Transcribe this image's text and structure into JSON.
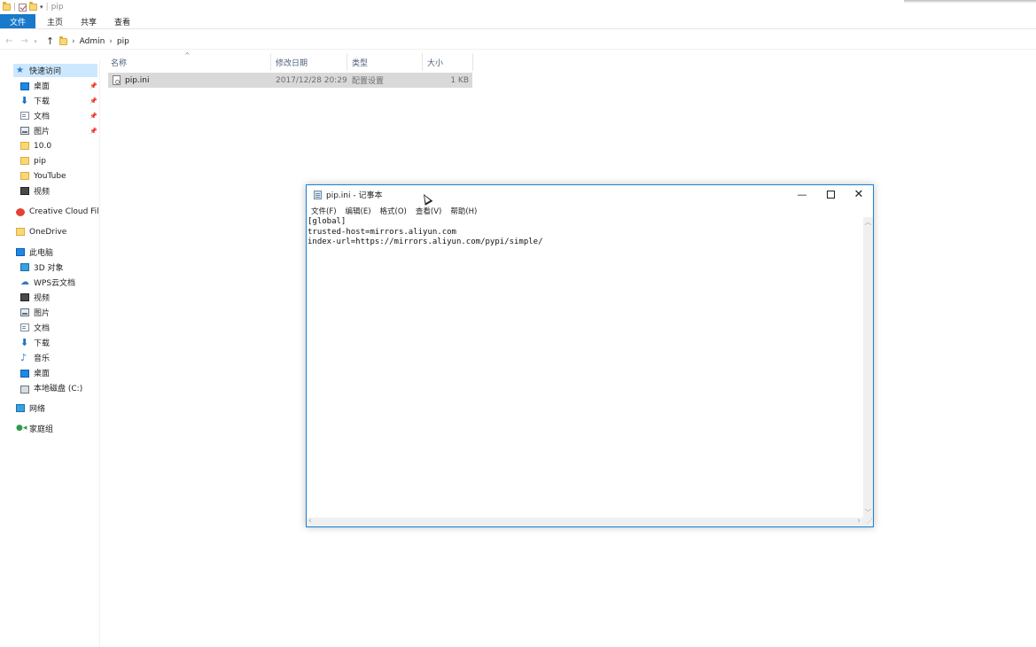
{
  "explorer": {
    "title": "pip",
    "ribbon_tabs": [
      "文件",
      "主页",
      "共享",
      "查看"
    ],
    "breadcrumb": [
      "Admin",
      "pip"
    ],
    "columns": [
      "名称",
      "修改日期",
      "类型",
      "大小"
    ],
    "files": [
      {
        "name": "pip.ini",
        "modified": "2017/12/28 20:29",
        "type": "配置设置",
        "size": "1 KB"
      }
    ],
    "sidebar": {
      "quick_access": "快速访问",
      "quick_items": [
        "桌面",
        "下载",
        "文档",
        "图片",
        "10.0",
        "pip",
        "YouTube",
        "视频"
      ],
      "creative_cloud": "Creative Cloud Files",
      "onedrive": "OneDrive",
      "this_pc": "此电脑",
      "pc_items": [
        "3D 对象",
        "WPS云文档",
        "视频",
        "图片",
        "文档",
        "下载",
        "音乐",
        "桌面",
        "本地磁盘 (C:)"
      ],
      "network": "网络",
      "homegroup": "家庭组"
    }
  },
  "notepad": {
    "title": "pip.ini - 记事本",
    "menu": [
      "文件(F)",
      "编辑(E)",
      "格式(O)",
      "查看(V)",
      "帮助(H)"
    ],
    "content": "[global]\ntrusted-host=mirrors.aliyun.com\nindex-url=https://mirrors.aliyun.com/pypi/simple/"
  },
  "colors": {
    "accent": "#1979ca",
    "selection": "#cce8ff",
    "row_selected": "#d9d9d9",
    "window_border": "#1883d7"
  }
}
